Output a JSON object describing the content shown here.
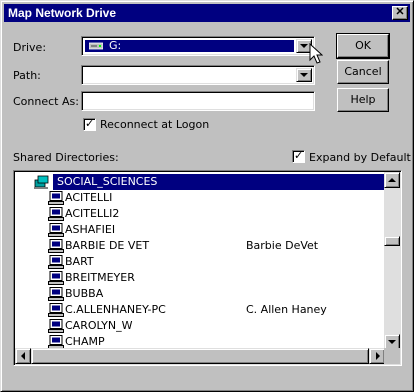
{
  "window": {
    "title": "Map Network Drive",
    "close_glyph": "✕"
  },
  "drive": {
    "label": "Drive:",
    "value": "G:",
    "icon": "network-drive-icon"
  },
  "path": {
    "label": "Path:",
    "value": ""
  },
  "connect_as": {
    "label": "Connect As:",
    "value": ""
  },
  "reconnect": {
    "label": "Reconnect at Logon",
    "checked": true
  },
  "buttons": {
    "ok": "OK",
    "cancel": "Cancel",
    "help": "Help"
  },
  "shared": {
    "label": "Shared Directories:"
  },
  "expand": {
    "label": "Expand by Default",
    "checked": true
  },
  "tree": {
    "root": "SOCIAL_SCIENCES",
    "items": [
      {
        "name": "ACITELLI",
        "comment": ""
      },
      {
        "name": "ACITELLI2",
        "comment": ""
      },
      {
        "name": "ASHAFIEI",
        "comment": ""
      },
      {
        "name": "BARBIE DE VET",
        "comment": "Barbie DeVet"
      },
      {
        "name": "BART",
        "comment": ""
      },
      {
        "name": "BREITMEYER",
        "comment": ""
      },
      {
        "name": "BUBBA",
        "comment": ""
      },
      {
        "name": "C.ALLENHANEY-PC",
        "comment": "C. Allen Haney"
      },
      {
        "name": "CAROLYN_W",
        "comment": ""
      },
      {
        "name": "CHAMP",
        "comment": ""
      }
    ]
  },
  "colors": {
    "selection": "#000080",
    "face": "#c0c0c0"
  }
}
